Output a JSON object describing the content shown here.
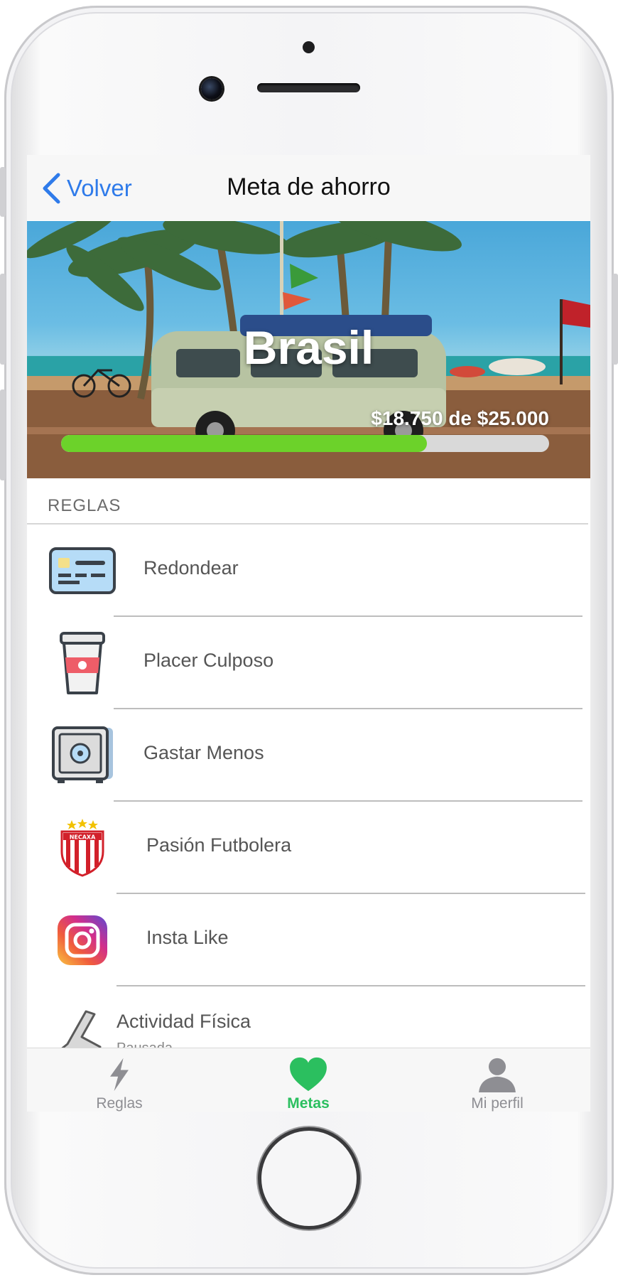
{
  "navbar": {
    "back_label": "Volver",
    "title": "Meta de ahorro"
  },
  "goal": {
    "name": "Brasil",
    "amount_text": "$18.750 de $25.000",
    "progress_fraction": 0.75
  },
  "rules_section": {
    "header": "REGLAS"
  },
  "rules": [
    {
      "label": "Redondear",
      "icon": "credit-card-icon"
    },
    {
      "label": "Placer Culposo",
      "icon": "coffee-cup-icon"
    },
    {
      "label": "Gastar Menos",
      "icon": "safe-icon"
    },
    {
      "label": "Pasión Futbolera",
      "icon": "necaxa-crest-icon"
    },
    {
      "label": "Insta Like",
      "icon": "instagram-icon"
    },
    {
      "label": "Actividad Física",
      "sublabel": "Pausada",
      "icon": "running-shoe-icon"
    }
  ],
  "tabbar": {
    "items": [
      {
        "label": "Reglas",
        "icon": "lightning-icon",
        "active": false
      },
      {
        "label": "Metas",
        "icon": "heart-icon",
        "active": true
      },
      {
        "label": "Mi perfil",
        "icon": "person-icon",
        "active": false
      }
    ]
  },
  "colors": {
    "accent": "#2f7bea",
    "progress": "#6cd22a",
    "active_tab": "#2bbf5f",
    "inactive_tab": "#8e8e93"
  }
}
